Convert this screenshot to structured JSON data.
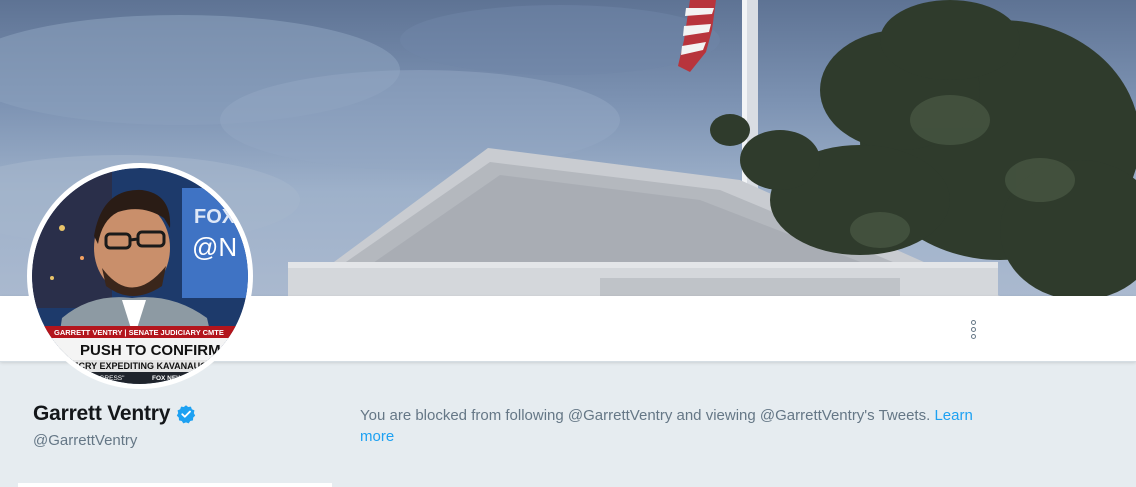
{
  "profile": {
    "display_name": "Garrett Ventry",
    "screen_name": "@GarrettVentry",
    "verified": true
  },
  "avatar": {
    "description_icon": "profile-photo",
    "chyron_top": "GARRETT VENTRY | SENATE JUDICIARY CMTE",
    "chyron_main": "PUSH TO CONFIRM",
    "chyron_sub": "DECRY EXPEDITING KAVANAUGH",
    "chyron_bottom": "DUOUS PROGRESS\"",
    "network": "FOX NEWS"
  },
  "blocked_notice": {
    "text": "You are blocked from following @GarrettVentry and viewing @GarrettVentry's Tweets. ",
    "link_label": "Learn more"
  },
  "icons": {
    "more": "vertical-ellipsis-icon",
    "verified": "verified-badge-icon"
  },
  "colors": {
    "link": "#1da1f2",
    "text_primary": "#14171a",
    "text_secondary": "#657786",
    "background": "#e6ecf0"
  }
}
